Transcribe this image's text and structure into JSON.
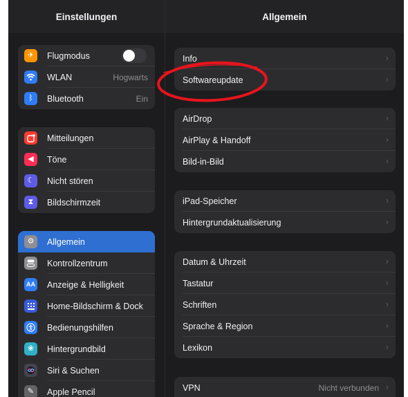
{
  "sidebar": {
    "title": "Einstellungen",
    "groups": [
      {
        "items": [
          {
            "label": "Flugmodus",
            "icon": "airplane-icon",
            "color": "#ff9500",
            "glyph": "✈",
            "toggle": true
          },
          {
            "label": "WLAN",
            "icon": "wifi-icon",
            "color": "#2f7cf6",
            "glyph": "≋",
            "value": "Hogwarts"
          },
          {
            "label": "Bluetooth",
            "icon": "bluetooth-icon",
            "color": "#2f7cf6",
            "glyph": "ᛒ",
            "value": "Ein"
          }
        ]
      },
      {
        "items": [
          {
            "label": "Mitteilungen",
            "icon": "notifications-icon",
            "color": "#ff3b30",
            "glyph": "▣"
          },
          {
            "label": "Töne",
            "icon": "sounds-icon",
            "color": "#ff2d55",
            "glyph": "◀"
          },
          {
            "label": "Nicht stören",
            "icon": "moon-icon",
            "color": "#5e5ce6",
            "glyph": "☾"
          },
          {
            "label": "Bildschirmzeit",
            "icon": "hourglass-icon",
            "color": "#5e5ce6",
            "glyph": "⧗"
          }
        ]
      },
      {
        "items": [
          {
            "label": "Allgemein",
            "icon": "gear-icon",
            "color": "#8e8e93",
            "glyph": "⚙",
            "selected": true
          },
          {
            "label": "Kontrollzentrum",
            "icon": "control-center-icon",
            "color": "#8e8e93",
            "glyph": "◧"
          },
          {
            "label": "Anzeige & Helligkeit",
            "icon": "display-icon",
            "color": "#2f7cf6",
            "glyph": "AA"
          },
          {
            "label": "Home-Bildschirm & Dock",
            "icon": "home-screen-icon",
            "color": "#3a5bd9",
            "glyph": "⠿"
          },
          {
            "label": "Bedienungshilfen",
            "icon": "accessibility-icon",
            "color": "#2f7cf6",
            "glyph": "♿"
          },
          {
            "label": "Hintergrundbild",
            "icon": "wallpaper-icon",
            "color": "#30b0c7",
            "glyph": "❀"
          },
          {
            "label": "Siri & Suchen",
            "icon": "siri-icon",
            "color": "#444450",
            "glyph": "◉"
          },
          {
            "label": "Apple Pencil",
            "icon": "pencil-icon",
            "color": "#636366",
            "glyph": "✎"
          }
        ]
      }
    ]
  },
  "detail": {
    "title": "Allgemein",
    "groups": [
      {
        "items": [
          {
            "label": "Info"
          },
          {
            "label": "Softwareupdate"
          }
        ]
      },
      {
        "items": [
          {
            "label": "AirDrop"
          },
          {
            "label": "AirPlay & Handoff"
          },
          {
            "label": "Bild-in-Bild"
          }
        ]
      },
      {
        "items": [
          {
            "label": "iPad-Speicher"
          },
          {
            "label": "Hintergrundaktualisierung"
          }
        ]
      },
      {
        "items": [
          {
            "label": "Datum & Uhrzeit"
          },
          {
            "label": "Tastatur"
          },
          {
            "label": "Schriften"
          },
          {
            "label": "Sprache & Region"
          },
          {
            "label": "Lexikon"
          }
        ]
      },
      {
        "items": [
          {
            "label": "VPN",
            "value": "Nicht verbunden"
          }
        ]
      }
    ]
  },
  "annotation": {
    "color": "#e8141c",
    "description": "red-ellipse-highlight"
  }
}
